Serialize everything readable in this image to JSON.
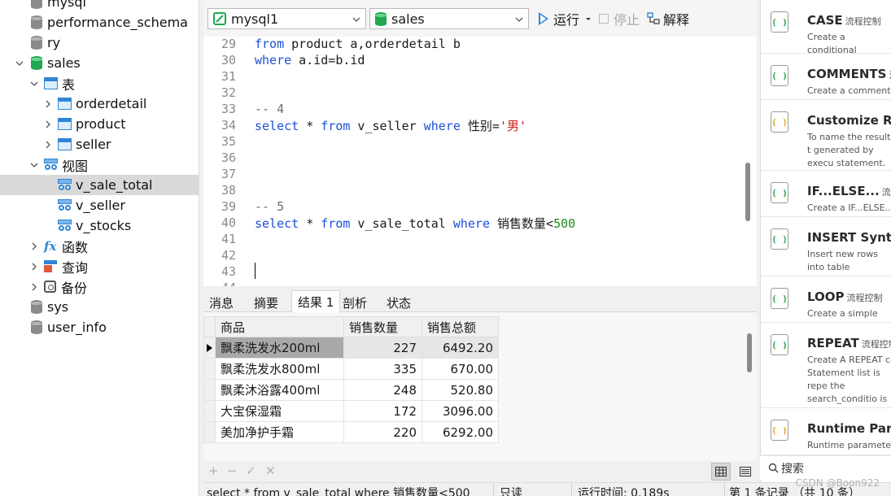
{
  "sidebar": {
    "items": [
      {
        "label": "mysql",
        "kind": "db"
      },
      {
        "label": "performance_schema",
        "kind": "db"
      },
      {
        "label": "ry",
        "kind": "db"
      },
      {
        "label": "sales",
        "kind": "db-open"
      },
      {
        "label": "表",
        "kind": "tables-folder"
      },
      {
        "label": "orderdetail",
        "kind": "table"
      },
      {
        "label": "product",
        "kind": "table"
      },
      {
        "label": "seller",
        "kind": "table"
      },
      {
        "label": "视图",
        "kind": "views-folder"
      },
      {
        "label": "v_sale_total",
        "kind": "view",
        "selected": true
      },
      {
        "label": "v_seller",
        "kind": "view"
      },
      {
        "label": "v_stocks",
        "kind": "view"
      },
      {
        "label": "函数",
        "kind": "functions"
      },
      {
        "label": "查询",
        "kind": "queries"
      },
      {
        "label": "备份",
        "kind": "backups"
      },
      {
        "label": "sys",
        "kind": "db"
      },
      {
        "label": "user_info",
        "kind": "db"
      }
    ]
  },
  "toolbar": {
    "connection": "mysql1",
    "database": "sales",
    "run_label": "运行",
    "stop_label": "停止",
    "explain_label": "解释"
  },
  "editor": {
    "lines": [
      {
        "n": "29",
        "tokens": [
          [
            "kw",
            "from"
          ],
          [
            "",
            " product a,orderdetail b"
          ]
        ]
      },
      {
        "n": "30",
        "tokens": [
          [
            "kw",
            "where"
          ],
          [
            "",
            " a.id=b.id"
          ]
        ]
      },
      {
        "n": "31",
        "tokens": []
      },
      {
        "n": "32",
        "tokens": []
      },
      {
        "n": "33",
        "tokens": [
          [
            "cmt",
            "-- 4"
          ]
        ]
      },
      {
        "n": "34",
        "tokens": [
          [
            "kw",
            "select"
          ],
          [
            "",
            " * "
          ],
          [
            "kw",
            "from"
          ],
          [
            "",
            " v_seller "
          ],
          [
            "kw",
            "where"
          ],
          [
            "",
            " 性别="
          ],
          [
            "str",
            "'男'"
          ]
        ]
      },
      {
        "n": "35",
        "tokens": []
      },
      {
        "n": "36",
        "tokens": []
      },
      {
        "n": "37",
        "tokens": []
      },
      {
        "n": "38",
        "tokens": []
      },
      {
        "n": "39",
        "tokens": [
          [
            "cmt",
            "-- 5"
          ]
        ]
      },
      {
        "n": "40",
        "tokens": [
          [
            "kw",
            "select"
          ],
          [
            "",
            " * "
          ],
          [
            "kw",
            "from"
          ],
          [
            "",
            " v_sale_total "
          ],
          [
            "kw",
            "where"
          ],
          [
            "",
            " 销售数量<"
          ],
          [
            "num",
            "500"
          ]
        ]
      },
      {
        "n": "41",
        "tokens": []
      },
      {
        "n": "42",
        "tokens": []
      },
      {
        "n": "43",
        "tokens": []
      },
      {
        "n": "44",
        "tokens": []
      }
    ]
  },
  "result_tabs": [
    "消息",
    "摘要",
    "结果 1",
    "剖析",
    "状态"
  ],
  "active_result_tab": "结果 1",
  "grid": {
    "columns": [
      "商品",
      "销售数量",
      "销售总额"
    ],
    "rows": [
      [
        "飘柔洗发水200ml",
        "227",
        "6492.20"
      ],
      [
        "飘柔洗发水800ml",
        "335",
        "670.00"
      ],
      [
        "飘柔沐浴露400ml",
        "248",
        "520.80"
      ],
      [
        "大宝保湿霜",
        "172",
        "3096.00"
      ],
      [
        "美加净护手霜",
        "220",
        "6292.00"
      ]
    ]
  },
  "grid_footer": {
    "add": "+",
    "remove": "−",
    "apply": "✓",
    "discard": "✕"
  },
  "status": {
    "sql": "select * from v_sale_total where 销售数量<500",
    "mode": "只读",
    "elapsed": "运行时间: 0.189s",
    "records": "第 1 条记录 （共 10 条）"
  },
  "snippets": [
    {
      "title": "CASE",
      "tag": "流程控制",
      "desc": "Create a conditional",
      "icon_color": "green"
    },
    {
      "title": "COMMENTS",
      "tag": "注",
      "desc": "Create a comment",
      "icon_color": "green"
    },
    {
      "title": "Customize Res",
      "tag": "",
      "desc": "To name the result t generated by execu statement.",
      "icon_color": "orange"
    },
    {
      "title": "IF...ELSE...",
      "tag": "流程控",
      "desc": "Create a IF...ELSE... c",
      "icon_color": "green"
    },
    {
      "title": "INSERT Syntax",
      "tag": "",
      "desc": "Insert new rows into table",
      "icon_color": "green"
    },
    {
      "title": "LOOP",
      "tag": "流程控制",
      "desc": "Create a simple loop",
      "icon_color": "green"
    },
    {
      "title": "REPEAT",
      "tag": "流程控制",
      "desc": "Create A REPEAT co Statement list is repe the search_conditio is true.",
      "icon_color": "green"
    },
    {
      "title": "Runtime Para",
      "tag": "",
      "desc": "Runtime parameter replaced when the c",
      "icon_color": "orange"
    }
  ],
  "snippet_search": "搜索",
  "watermark": "CSDN @Boon922"
}
